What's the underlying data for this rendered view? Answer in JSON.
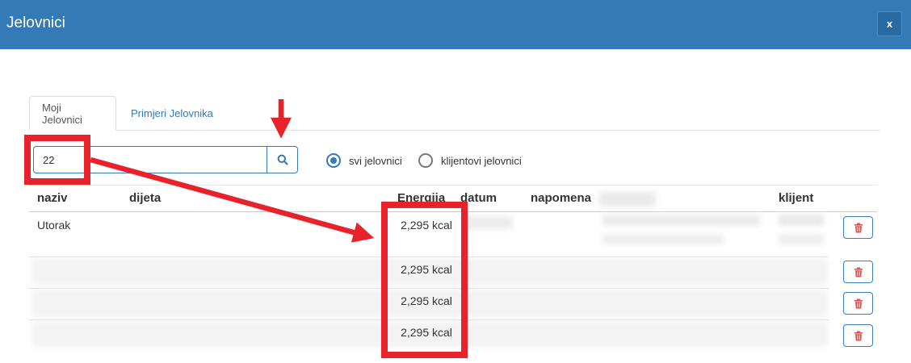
{
  "modal": {
    "title": "Jelovnici",
    "close_label": "x"
  },
  "tabs": [
    {
      "label": "Moji Jelovnici",
      "active": true
    },
    {
      "label": "Primjeri Jelovnika",
      "active": false
    }
  ],
  "search": {
    "value": "22",
    "icon": "search-icon"
  },
  "filters": [
    {
      "label": "svi jelovnici",
      "checked": true
    },
    {
      "label": "klijentovi jelovnici",
      "checked": false
    }
  ],
  "table": {
    "headers": {
      "naziv": "naziv",
      "dijeta": "dijeta",
      "energija": "Energija",
      "datum": "datum",
      "napomena": "napomena",
      "klijent": "klijent"
    },
    "rows": [
      {
        "naziv": "Utorak",
        "energija": "2,295 kcal",
        "blurred": false
      },
      {
        "energija": "2,295 kcal",
        "blurred": true
      },
      {
        "energija": "2,295 kcal",
        "blurred": true
      },
      {
        "energija": "2,295 kcal",
        "blurred": true
      }
    ]
  },
  "colors": {
    "header_bg": "#337ab7",
    "accent": "#337ab7",
    "danger": "#d9534f",
    "annotation": "#e8222a"
  }
}
